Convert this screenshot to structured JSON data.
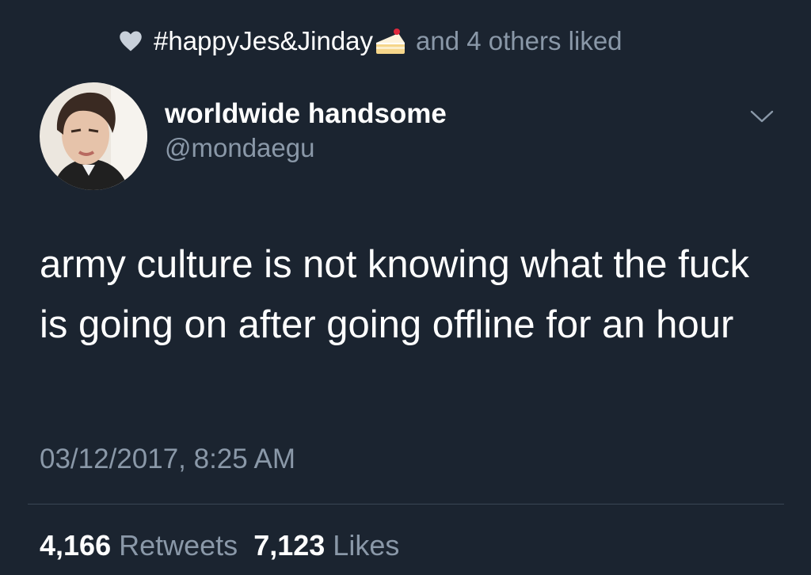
{
  "liked_bar": {
    "icon": "heart-icon",
    "user": "#happyJes&Jinday",
    "user_emoji": "cake-icon",
    "suffix": "and 4 others liked"
  },
  "profile": {
    "display_name": "worldwide handsome",
    "handle": "@mondaegu",
    "menu_icon": "chevron-down-icon"
  },
  "tweet": {
    "text": "army culture is not knowing what the fuck is going on after going offline for an hour",
    "timestamp": "03/12/2017, 8:25 AM"
  },
  "stats": {
    "retweets_count": "4,166",
    "retweets_label": "Retweets",
    "likes_count": "7,123",
    "likes_label": "Likes"
  },
  "colors": {
    "background": "#1b2430",
    "primary_text": "#ffffff",
    "secondary_text": "#8a98a8",
    "divider": "#3a4654"
  }
}
